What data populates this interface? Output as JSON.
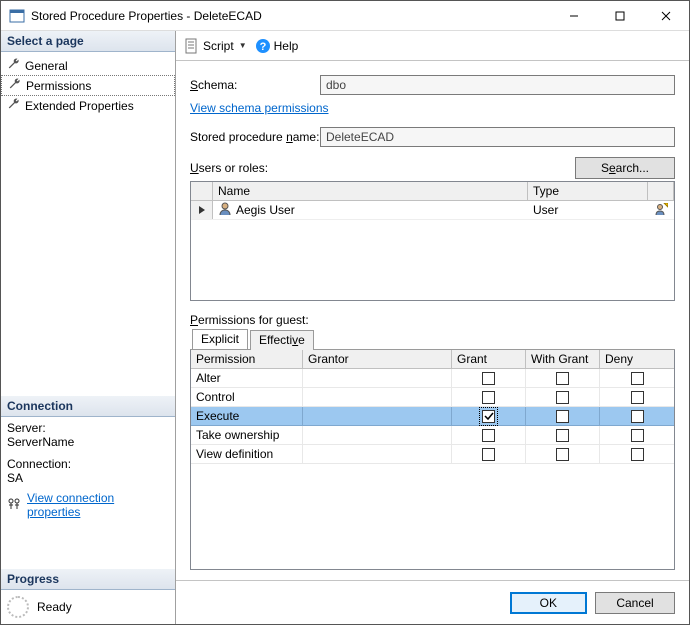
{
  "title": "Stored Procedure Properties - DeleteECAD",
  "sidebar": {
    "selectHeader": "Select a page",
    "items": [
      {
        "label": "General"
      },
      {
        "label": "Permissions"
      },
      {
        "label": "Extended Properties"
      }
    ],
    "connection": {
      "header": "Connection",
      "serverLbl": "Server:",
      "serverVal": "ServerName",
      "connLbl": "Connection:",
      "connVal": "SA",
      "viewLink": "View connection properties"
    },
    "progress": {
      "header": "Progress",
      "status": "Ready"
    }
  },
  "toolbar": {
    "script": "Script",
    "help": "Help"
  },
  "form": {
    "schemaLbl": "Schema:",
    "schemaVal": "dbo",
    "viewPermLink": "View schema permissions",
    "spNameLbl": "Stored procedure name:",
    "spNameVal": "DeleteECAD",
    "usersLbl": "Users or roles:",
    "searchBtn": "Search..."
  },
  "usersGrid": {
    "headers": {
      "name": "Name",
      "type": "Type"
    },
    "rows": [
      {
        "name": "Aegis User",
        "type": "User"
      }
    ]
  },
  "permSection": {
    "label": "Permissions for guest:",
    "tabs": {
      "explicit": "Explicit",
      "effective": "Effective"
    },
    "headers": {
      "permission": "Permission",
      "grantor": "Grantor",
      "grant": "Grant",
      "withGrant": "With Grant",
      "deny": "Deny"
    },
    "rows": [
      {
        "name": "Alter",
        "grant": false,
        "with": false,
        "deny": false,
        "sel": false
      },
      {
        "name": "Control",
        "grant": false,
        "with": false,
        "deny": false,
        "sel": false
      },
      {
        "name": "Execute",
        "grant": true,
        "with": false,
        "deny": false,
        "sel": true
      },
      {
        "name": "Take ownership",
        "grant": false,
        "with": false,
        "deny": false,
        "sel": false
      },
      {
        "name": "View definition",
        "grant": false,
        "with": false,
        "deny": false,
        "sel": false
      }
    ]
  },
  "footer": {
    "ok": "OK",
    "cancel": "Cancel"
  }
}
